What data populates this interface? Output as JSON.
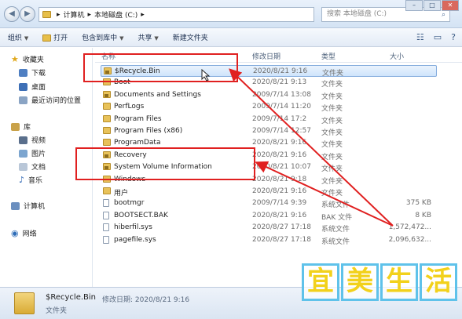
{
  "address_bar": {
    "back_icon": "back-arrow-icon",
    "forward_icon": "forward-arrow-icon",
    "crumbs": [
      "计算机",
      "本地磁盘 (C:)"
    ],
    "search_placeholder": "搜索 本地磁盘 (C:)",
    "window_controls": [
      "–",
      "□",
      "✕"
    ]
  },
  "toolbar": {
    "organize": "组织",
    "open": "打开",
    "include_in_library": "包含到库中",
    "share": "共享",
    "new_folder": "新建文件夹"
  },
  "sidebar": {
    "favorites": "收藏夹",
    "downloads": "下载",
    "desktop": "桌面",
    "recent": "最近访问的位置",
    "libraries": "库",
    "videos": "视频",
    "pictures": "图片",
    "documents": "文档",
    "music": "音乐",
    "computer": "计算机",
    "network": "网络"
  },
  "columns": {
    "name": "名称",
    "date": "修改日期",
    "type": "类型",
    "size": "大小"
  },
  "files": [
    {
      "name": "$Recycle.Bin",
      "date": "2020/8/21 9:16",
      "type": "文件夹",
      "size": "",
      "icon": "locked-folder"
    },
    {
      "name": "Boot",
      "date": "2020/8/21 9:13",
      "type": "文件夹",
      "size": "",
      "icon": "folder"
    },
    {
      "name": "Documents and Settings",
      "date": "2009/7/14 13:08",
      "type": "文件夹",
      "size": "",
      "icon": "locked-folder"
    },
    {
      "name": "PerfLogs",
      "date": "2009/7/14 11:20",
      "type": "文件夹",
      "size": "",
      "icon": "folder"
    },
    {
      "name": "Program Files",
      "date": "2009/7/14 17:2",
      "type": "文件夹",
      "size": "",
      "icon": "folder"
    },
    {
      "name": "Program Files (x86)",
      "date": "2009/7/14 12:57",
      "type": "文件夹",
      "size": "",
      "icon": "folder"
    },
    {
      "name": "ProgramData",
      "date": "2020/8/21 9:16",
      "type": "文件夹",
      "size": "",
      "icon": "folder"
    },
    {
      "name": "Recovery",
      "date": "2020/8/21 9:16",
      "type": "文件夹",
      "size": "",
      "icon": "locked-folder"
    },
    {
      "name": "System Volume Information",
      "date": "2020/8/21 10:07",
      "type": "文件夹",
      "size": "",
      "icon": "locked-folder"
    },
    {
      "name": "Windows",
      "date": "2020/8/21 9:18",
      "type": "文件夹",
      "size": "",
      "icon": "folder"
    },
    {
      "name": "用户",
      "date": "2020/8/21 9:16",
      "type": "文件夹",
      "size": "",
      "icon": "folder"
    },
    {
      "name": "bootmgr",
      "date": "2009/7/14 9:39",
      "type": "系统文件",
      "size": "375 KB",
      "icon": "file"
    },
    {
      "name": "BOOTSECT.BAK",
      "date": "2020/8/21 9:16",
      "type": "BAK 文件",
      "size": "8 KB",
      "icon": "file"
    },
    {
      "name": "hiberfil.sys",
      "date": "2020/8/27 17:18",
      "type": "系统文件",
      "size": "1,572,472...",
      "icon": "file"
    },
    {
      "name": "pagefile.sys",
      "date": "2020/8/27 17:18",
      "type": "系统文件",
      "size": "2,096,632...",
      "icon": "file"
    }
  ],
  "status": {
    "name": "$Recycle.Bin",
    "modified_label": "修改日期: 2020/8/21 9:16",
    "type": "文件夹"
  },
  "watermark": [
    "宜",
    "美",
    "生",
    "活"
  ],
  "colors": {
    "highlight": "#e02020",
    "watermark_border": "#5fc2ea",
    "watermark_text": "#f2d11b"
  }
}
